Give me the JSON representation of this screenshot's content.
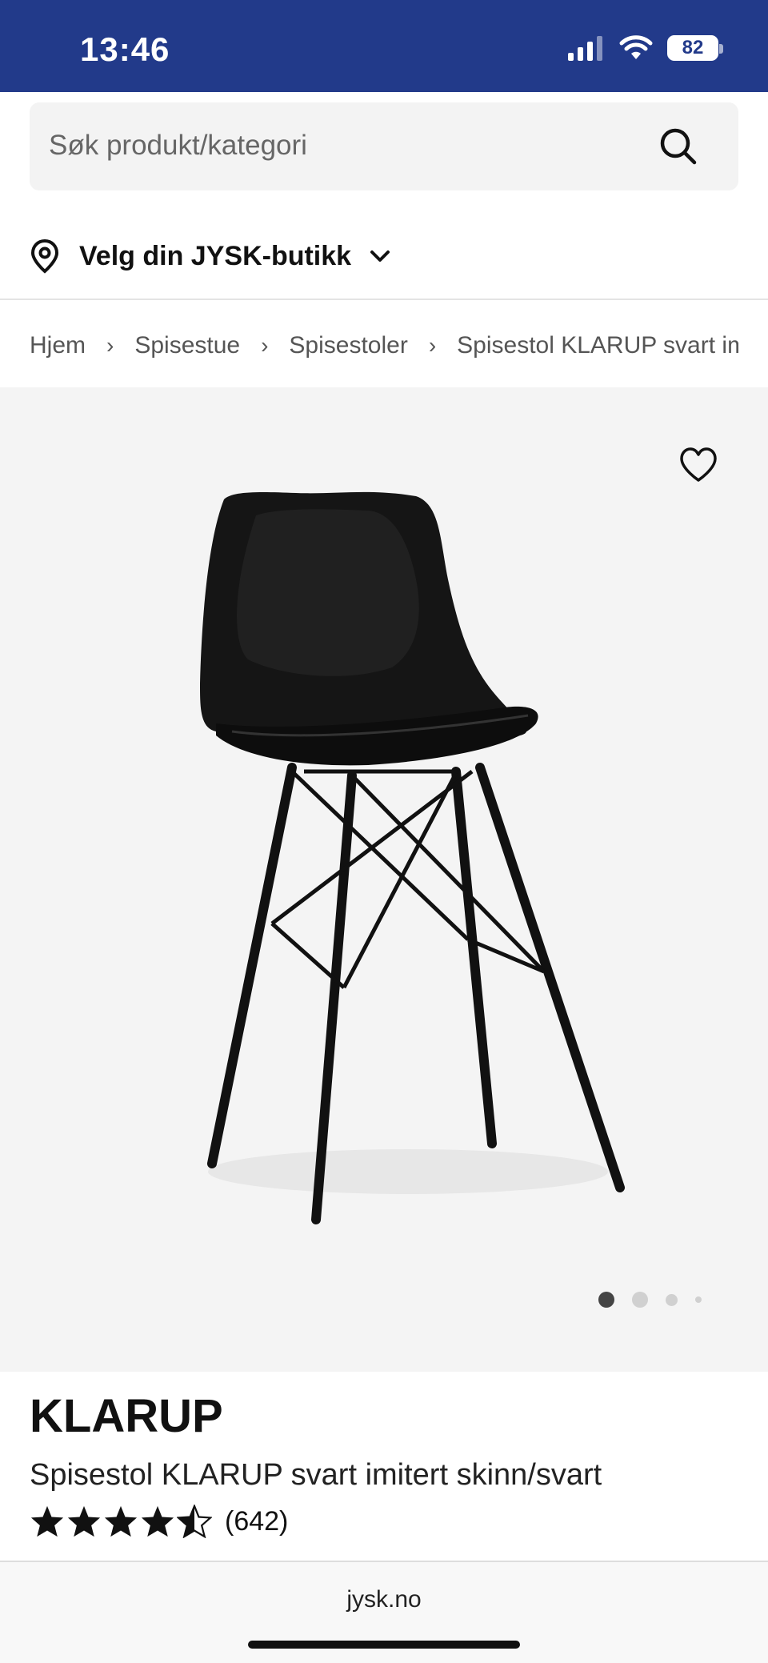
{
  "status_bar": {
    "time": "13:46",
    "battery": "82",
    "background": "#223a8a"
  },
  "search": {
    "placeholder": "Søk produkt/kategori",
    "icon": "search-icon"
  },
  "store": {
    "label": "Velg din JYSK-butikk",
    "icon": "location-pin-icon"
  },
  "breadcrumb": [
    "Hjem",
    "Spisestue",
    "Spisestoler",
    "Spisestol KLARUP svart imit"
  ],
  "gallery": {
    "image": "black dining chair with black metal legs",
    "slide_count": 4,
    "active_slide": 1,
    "favorite_icon": "heart-icon"
  },
  "product": {
    "name": "KLARUP",
    "subtitle": "Spisestol KLARUP svart imitert skinn/svart",
    "rating": 4.5,
    "rating_max": 5,
    "review_count": "(642)"
  },
  "browser": {
    "url": "jysk.no"
  }
}
